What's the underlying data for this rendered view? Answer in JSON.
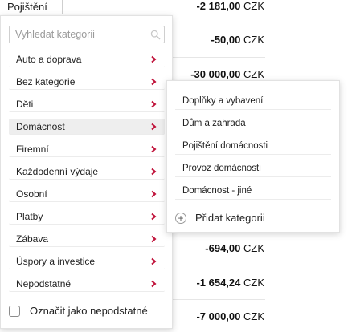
{
  "header": {
    "category": "Pojištění"
  },
  "amounts": [
    {
      "value": "-2 181,00",
      "currency": "CZK"
    },
    {
      "value": "-50,00",
      "currency": "CZK"
    },
    {
      "value": "-30 000,00",
      "currency": "CZK"
    },
    {
      "value": "-694,00",
      "currency": "CZK"
    },
    {
      "value": "-1 654,24",
      "currency": "CZK"
    },
    {
      "value": "-7 000,00",
      "currency": "CZK"
    }
  ],
  "search": {
    "placeholder": "Vyhledat kategorii",
    "value": ""
  },
  "categories": [
    {
      "label": "Auto a doprava"
    },
    {
      "label": "Bez kategorie"
    },
    {
      "label": "Děti"
    },
    {
      "label": "Domácnost"
    },
    {
      "label": "Firemní"
    },
    {
      "label": "Každodenní výdaje"
    },
    {
      "label": "Osobní"
    },
    {
      "label": "Platby"
    },
    {
      "label": "Zábava"
    },
    {
      "label": "Úspory a investice"
    },
    {
      "label": "Nepodstatné"
    }
  ],
  "mark_unimportant": {
    "label": "Označit jako nepodstatné",
    "checked": false
  },
  "subcategories": [
    {
      "label": "Doplňky a vybavení"
    },
    {
      "label": "Dům a zahrada"
    },
    {
      "label": "Pojištění domácnosti"
    },
    {
      "label": "Provoz domácnosti"
    },
    {
      "label": "Domácnost - jiné"
    }
  ],
  "add_category": {
    "label": "Přidat kategorii"
  },
  "colors": {
    "chevron": "#c0123a",
    "active_row": "#eeeeee"
  }
}
